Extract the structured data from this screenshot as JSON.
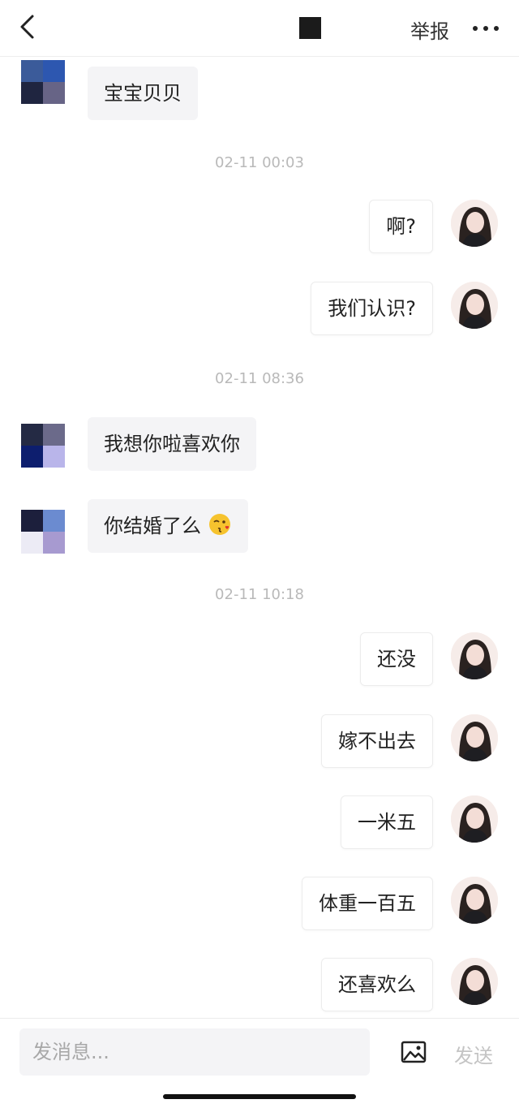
{
  "header": {
    "report_label": "举报",
    "back_icon": "chevron-left-icon",
    "more_icon": "more-dots-icon"
  },
  "timestamps": [
    "02-11 00:03",
    "02-11 08:36",
    "02-11 10:18"
  ],
  "messages": {
    "m0": "宝宝贝贝",
    "m1": "啊?",
    "m2": "我们认识?",
    "m3": "我想你啦喜欢你",
    "m4": "你结婚了么",
    "m5": "还没",
    "m6": "嫁不出去",
    "m7": "一米五",
    "m8": "体重一百五",
    "m9": "还喜欢么"
  },
  "emoji": {
    "m4": "kissing-face-emoji"
  },
  "composer": {
    "placeholder": "发消息...",
    "send_label": "发送",
    "image_icon": "image-icon"
  }
}
